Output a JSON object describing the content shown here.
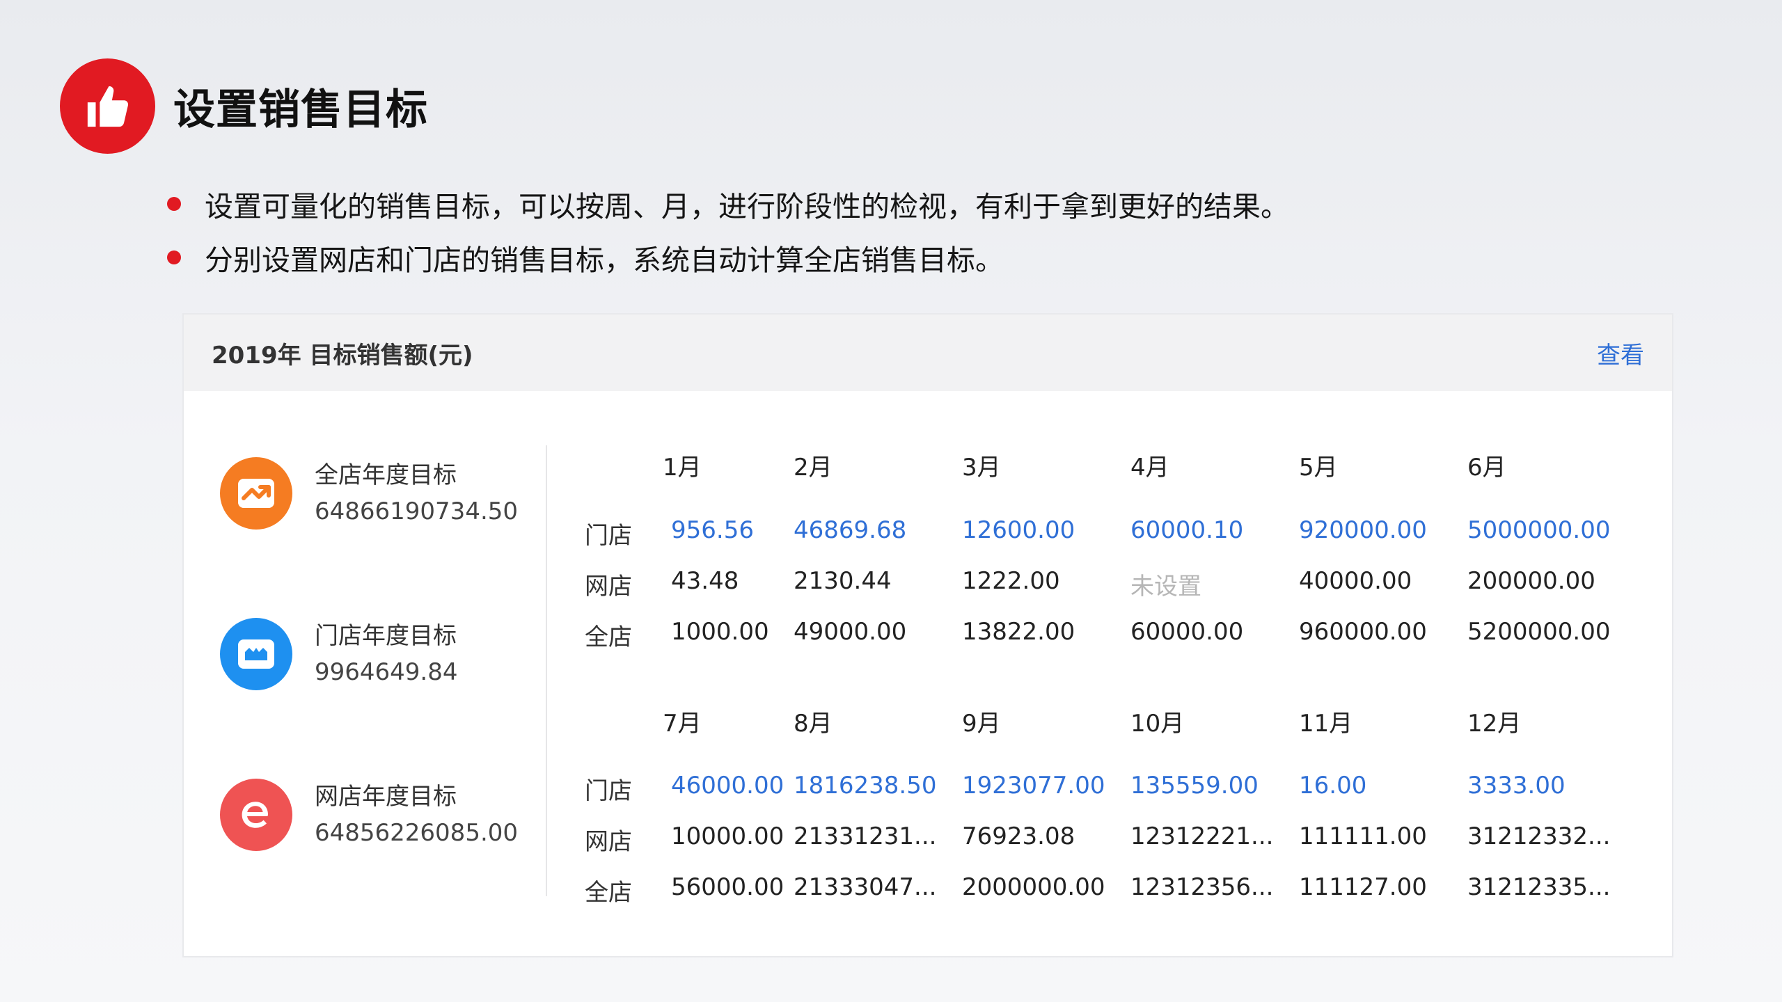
{
  "slide": {
    "title": "设置销售目标",
    "bullets": [
      "设置可量化的销售目标，可以按周、月，进行阶段性的检视，有利于拿到更好的结果。",
      "分别设置网店和门店的销售目标，系统自动计算全店销售目标。"
    ]
  },
  "card": {
    "title": "2019年 目标销售额(元)",
    "view_link": "查看",
    "summary": [
      {
        "label": "全店年度目标",
        "value": "64866190734.50",
        "icon": "trend-chart-icon",
        "color": "#f57c22"
      },
      {
        "label": "门店年度目标",
        "value": "9964649.84",
        "icon": "store-icon",
        "color": "#1e90f0"
      },
      {
        "label": "网店年度目标",
        "value": "64856226085.00",
        "icon": "e-shop-icon",
        "color": "#ef5353"
      }
    ],
    "row_labels": [
      "门店",
      "网店",
      "全店"
    ],
    "first_half": {
      "months": [
        "1月",
        "2月",
        "3月",
        "4月",
        "5月",
        "6月"
      ],
      "store": [
        "956.56",
        "46869.68",
        "12600.00",
        "60000.10",
        "920000.00",
        "5000000.00"
      ],
      "online": [
        "43.48",
        "2130.44",
        "1222.00",
        "未设置",
        "40000.00",
        "200000.00"
      ],
      "total": [
        "1000.00",
        "49000.00",
        "13822.00",
        "60000.00",
        "960000.00",
        "5200000.00"
      ]
    },
    "second_half": {
      "months": [
        "7月",
        "8月",
        "9月",
        "10月",
        "11月",
        "12月"
      ],
      "store": [
        "46000.00",
        "1816238.50",
        "1923077.00",
        "135559.00",
        "16.00",
        "3333.00"
      ],
      "online": [
        "10000.00",
        "21331231...",
        "76923.08",
        "12312221...",
        "111111.00",
        "31212332..."
      ],
      "total": [
        "56000.00",
        "21333047...",
        "2000000.00",
        "12312356...",
        "111127.00",
        "31212335..."
      ]
    },
    "colors": {
      "link": "#2f6fd6",
      "unset": "#b6b6b6",
      "accent": "#e11a22"
    }
  }
}
